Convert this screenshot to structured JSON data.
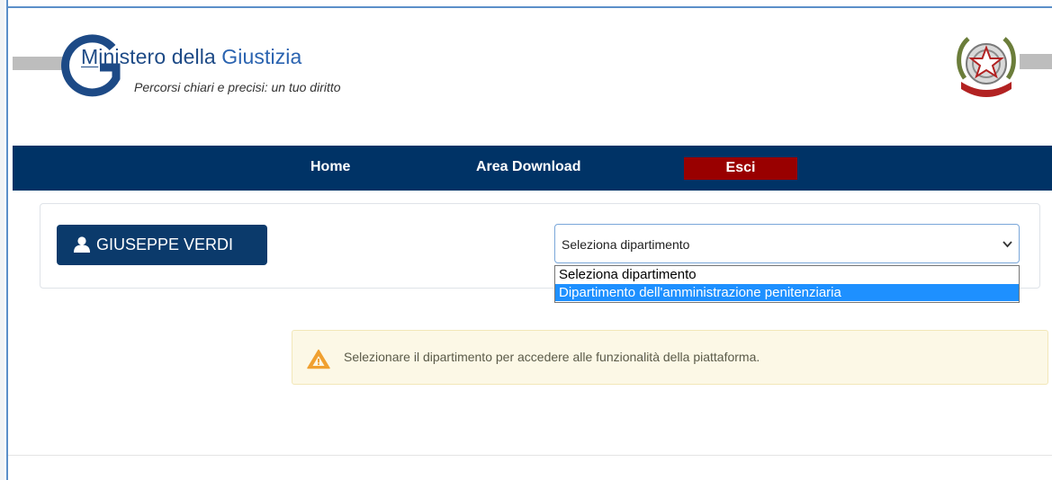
{
  "header": {
    "title_prefix": "M",
    "title_mid": "inistero della ",
    "title_accent": "Giustizia",
    "subtitle": "Percorsi chiari e precisi: un tuo diritto"
  },
  "nav": {
    "home": "Home",
    "download": "Area Download",
    "exit": "Esci"
  },
  "user": {
    "name": "GIUSEPPE VERDI"
  },
  "department_select": {
    "selected": "Seleziona dipartimento",
    "options": [
      "Seleziona dipartimento",
      "Dipartimento dell'amministrazione penitenziaria"
    ],
    "highlighted_index": 1
  },
  "alert": {
    "message": "Selezionare il dipartimento per accedere alle funzionalità della piattaforma."
  },
  "colors": {
    "nav_bg": "#003366",
    "exit_bg": "#990000",
    "user_btn_bg": "#0b3a6b",
    "option_highlight": "#1e90ff",
    "alert_bg": "#fcf8e6",
    "warning_icon": "#f0a030"
  },
  "icons": {
    "user": "user-icon",
    "chevron": "chevron-down-icon",
    "warning": "warning-icon",
    "emblem": "italian-republic-emblem"
  }
}
